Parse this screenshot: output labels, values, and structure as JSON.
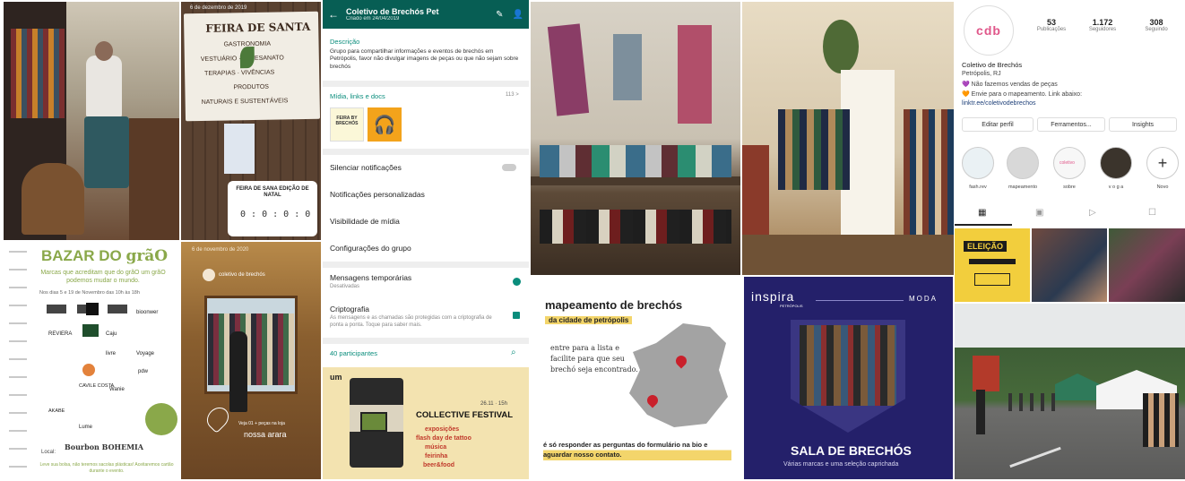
{
  "whatsapp": {
    "group_name": "Coletivo de Brechós Pet",
    "created": "Criado em 24/04/2019",
    "description_label": "Descrição",
    "description_text": "Grupo para compartilhar informações e eventos de brechós em Petrópolis, favor não divulgar imagens de peças ou que não sejam sobre brechós",
    "media_label": "Mídia, links e docs",
    "media_count": "113 >",
    "mute": "Silenciar notificações",
    "custom_notif": "Notificações personalizadas",
    "media_visibility": "Visibilidade de mídia",
    "group_settings": "Configurações do grupo",
    "temp_messages": "Mensagens temporárias",
    "temp_status": "Desativadas",
    "encryption": "Criptografia",
    "encryption_desc": "As mensagens e as chamadas são protegidas com a criptografia de ponta a ponta. Toque para saber mais.",
    "participants": "40 participantes",
    "media_thumb_text": "FEIRA BY BRECHÓS"
  },
  "instagram": {
    "logo": "cdb",
    "posts": "53",
    "posts_label": "Publicações",
    "followers": "1.172",
    "followers_label": "Seguidores",
    "following": "308",
    "following_label": "Seguindo",
    "name": "Coletivo de Brechós",
    "location": "Petrópolis, RJ",
    "bio1": "💜 Não fazemos vendas de peças",
    "bio2": "🧡 Envie para o mapeamento. Link abaixo:",
    "link": "linktr.ee/coletivodebrechos",
    "btn_edit": "Editar perfil",
    "btn_tools": "Ferramentos...",
    "btn_insights": "Insights",
    "stories": [
      "fash.rev",
      "mapeamento",
      "sobre",
      "v o g a",
      "Novo"
    ],
    "story_colorful": "coletivo",
    "post_eleicao": "ELEIÇÃO"
  },
  "feira_banner": {
    "date": "6 de dezembro de 2019",
    "line1": "FEIRA DE SANTA",
    "line2": "GASTRONOMIA",
    "line3": "VESTUÁRIO · ARTESANATO",
    "line4": "TERAPIAS · VIVÊNCIAS",
    "line5": "PRODUTOS",
    "line6": "NATURAIS E SUSTENTÁVEIS",
    "countdown_title": "FEIRA DE SANA EDIÇÃO DE NATAL",
    "countdown": "0 : 0 : 0 : 0"
  },
  "bazar": {
    "title1": "BAZAR DO ",
    "title2": "grãO",
    "subtitle": "Marcas que acreditam que do grãO um grãO podemos mudar o mundo.",
    "dates": "Nos dias 5 e 19 de Novembro das 10h às 18h",
    "brands": [
      "bioonwer",
      "REVIERA",
      "Caju",
      "livre",
      "Voyage",
      "pdw",
      "CAVILE COSTA",
      "Wanie",
      "AKABE",
      "Lume"
    ],
    "sponsor_label": "Local:",
    "sponsor": "Bourbon BOHEMIA",
    "footer": "Leve sua bolsa, não teremos sacolas plásticas! Aceitaremos cartão durante o evento."
  },
  "store_story": {
    "date": "6 de novembro de 2020",
    "account": "coletivo de brechós",
    "caption": "nossa arara",
    "caption_small": "Veja 01 + peças na loja"
  },
  "collective_festival": {
    "logo": "um",
    "date": "26.11 · 15h",
    "title": "COLLECTIVE FESTIVAL",
    "items": [
      "exposições",
      "flash day de tattoo",
      "música",
      "feirinha",
      "beer&food"
    ]
  },
  "mapeamento": {
    "title": "mapeamento de brechós",
    "subtitle": "da cidade de petrópolis",
    "body": "entre para a lista e facilite para que seu brechó seja encontrado.",
    "footer": "é só responder as perguntas do formulário na bio e aguardar nosso contato."
  },
  "inspira": {
    "brand": "inspira",
    "brand_sub": "PETRÓPOLIS",
    "category": "MODA",
    "title": "SALA DE BRECHÓS",
    "subtitle": "Várias marcas e uma seleção caprichada"
  },
  "colors": {
    "whatsapp_green": "#075E54",
    "accent_teal": "#0a8d7c",
    "bazar_green": "#8aa84a",
    "festival_yellow": "#f3e3b0",
    "inspira_navy": "#24206a",
    "map_gray": "#a3a3a3",
    "map_pin": "#c9202b"
  }
}
